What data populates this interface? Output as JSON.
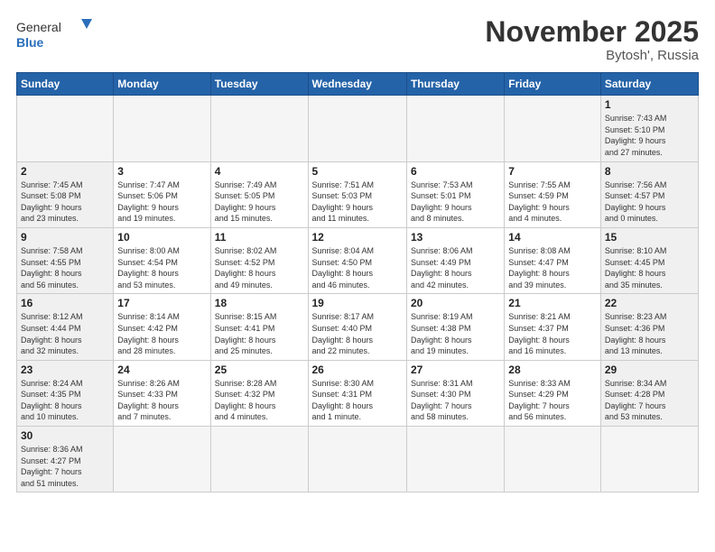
{
  "header": {
    "logo_general": "General",
    "logo_blue": "Blue",
    "month_title": "November 2025",
    "location": "Bytosh', Russia"
  },
  "weekdays": [
    "Sunday",
    "Monday",
    "Tuesday",
    "Wednesday",
    "Thursday",
    "Friday",
    "Saturday"
  ],
  "days": {
    "d1": {
      "n": "1",
      "info": "Sunrise: 7:43 AM\nSunset: 5:10 PM\nDaylight: 9 hours\nand 27 minutes."
    },
    "d2": {
      "n": "2",
      "info": "Sunrise: 7:45 AM\nSunset: 5:08 PM\nDaylight: 9 hours\nand 23 minutes."
    },
    "d3": {
      "n": "3",
      "info": "Sunrise: 7:47 AM\nSunset: 5:06 PM\nDaylight: 9 hours\nand 19 minutes."
    },
    "d4": {
      "n": "4",
      "info": "Sunrise: 7:49 AM\nSunset: 5:05 PM\nDaylight: 9 hours\nand 15 minutes."
    },
    "d5": {
      "n": "5",
      "info": "Sunrise: 7:51 AM\nSunset: 5:03 PM\nDaylight: 9 hours\nand 11 minutes."
    },
    "d6": {
      "n": "6",
      "info": "Sunrise: 7:53 AM\nSunset: 5:01 PM\nDaylight: 9 hours\nand 8 minutes."
    },
    "d7": {
      "n": "7",
      "info": "Sunrise: 7:55 AM\nSunset: 4:59 PM\nDaylight: 9 hours\nand 4 minutes."
    },
    "d8": {
      "n": "8",
      "info": "Sunrise: 7:56 AM\nSunset: 4:57 PM\nDaylight: 9 hours\nand 0 minutes."
    },
    "d9": {
      "n": "9",
      "info": "Sunrise: 7:58 AM\nSunset: 4:55 PM\nDaylight: 8 hours\nand 56 minutes."
    },
    "d10": {
      "n": "10",
      "info": "Sunrise: 8:00 AM\nSunset: 4:54 PM\nDaylight: 8 hours\nand 53 minutes."
    },
    "d11": {
      "n": "11",
      "info": "Sunrise: 8:02 AM\nSunset: 4:52 PM\nDaylight: 8 hours\nand 49 minutes."
    },
    "d12": {
      "n": "12",
      "info": "Sunrise: 8:04 AM\nSunset: 4:50 PM\nDaylight: 8 hours\nand 46 minutes."
    },
    "d13": {
      "n": "13",
      "info": "Sunrise: 8:06 AM\nSunset: 4:49 PM\nDaylight: 8 hours\nand 42 minutes."
    },
    "d14": {
      "n": "14",
      "info": "Sunrise: 8:08 AM\nSunset: 4:47 PM\nDaylight: 8 hours\nand 39 minutes."
    },
    "d15": {
      "n": "15",
      "info": "Sunrise: 8:10 AM\nSunset: 4:45 PM\nDaylight: 8 hours\nand 35 minutes."
    },
    "d16": {
      "n": "16",
      "info": "Sunrise: 8:12 AM\nSunset: 4:44 PM\nDaylight: 8 hours\nand 32 minutes."
    },
    "d17": {
      "n": "17",
      "info": "Sunrise: 8:14 AM\nSunset: 4:42 PM\nDaylight: 8 hours\nand 28 minutes."
    },
    "d18": {
      "n": "18",
      "info": "Sunrise: 8:15 AM\nSunset: 4:41 PM\nDaylight: 8 hours\nand 25 minutes."
    },
    "d19": {
      "n": "19",
      "info": "Sunrise: 8:17 AM\nSunset: 4:40 PM\nDaylight: 8 hours\nand 22 minutes."
    },
    "d20": {
      "n": "20",
      "info": "Sunrise: 8:19 AM\nSunset: 4:38 PM\nDaylight: 8 hours\nand 19 minutes."
    },
    "d21": {
      "n": "21",
      "info": "Sunrise: 8:21 AM\nSunset: 4:37 PM\nDaylight: 8 hours\nand 16 minutes."
    },
    "d22": {
      "n": "22",
      "info": "Sunrise: 8:23 AM\nSunset: 4:36 PM\nDaylight: 8 hours\nand 13 minutes."
    },
    "d23": {
      "n": "23",
      "info": "Sunrise: 8:24 AM\nSunset: 4:35 PM\nDaylight: 8 hours\nand 10 minutes."
    },
    "d24": {
      "n": "24",
      "info": "Sunrise: 8:26 AM\nSunset: 4:33 PM\nDaylight: 8 hours\nand 7 minutes."
    },
    "d25": {
      "n": "25",
      "info": "Sunrise: 8:28 AM\nSunset: 4:32 PM\nDaylight: 8 hours\nand 4 minutes."
    },
    "d26": {
      "n": "26",
      "info": "Sunrise: 8:30 AM\nSunset: 4:31 PM\nDaylight: 8 hours\nand 1 minute."
    },
    "d27": {
      "n": "27",
      "info": "Sunrise: 8:31 AM\nSunset: 4:30 PM\nDaylight: 7 hours\nand 58 minutes."
    },
    "d28": {
      "n": "28",
      "info": "Sunrise: 8:33 AM\nSunset: 4:29 PM\nDaylight: 7 hours\nand 56 minutes."
    },
    "d29": {
      "n": "29",
      "info": "Sunrise: 8:34 AM\nSunset: 4:28 PM\nDaylight: 7 hours\nand 53 minutes."
    },
    "d30": {
      "n": "30",
      "info": "Sunrise: 8:36 AM\nSunset: 4:27 PM\nDaylight: 7 hours\nand 51 minutes."
    }
  }
}
